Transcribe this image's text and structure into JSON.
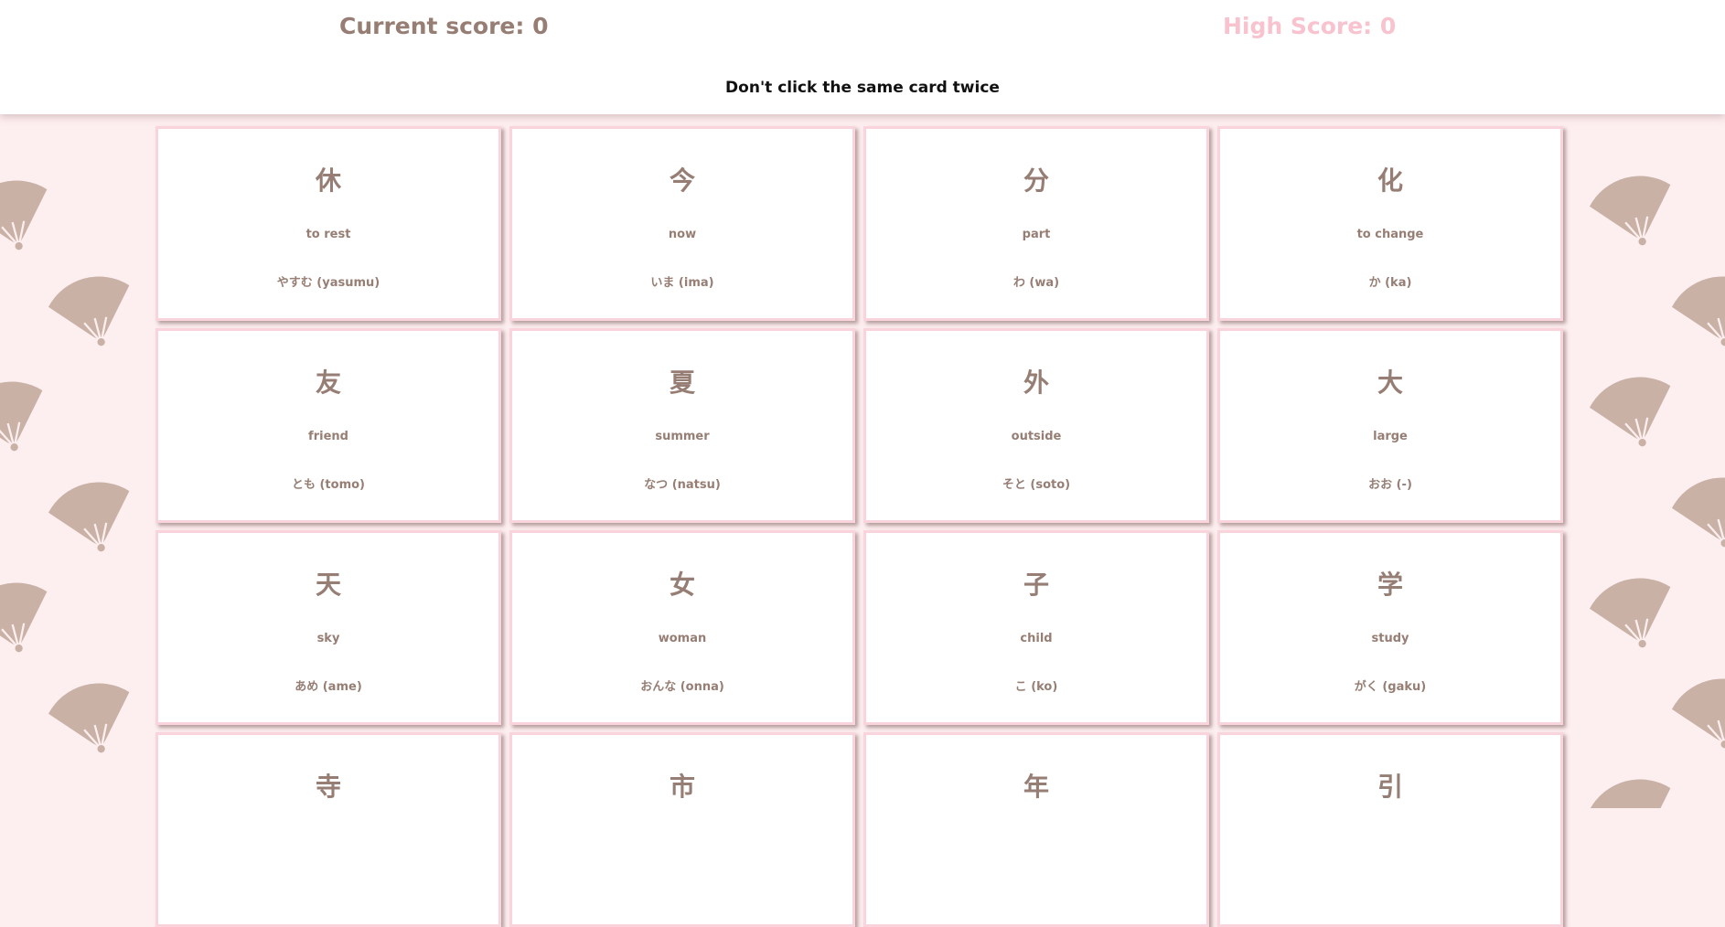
{
  "scoreboard": {
    "current_label": "Current score: 0",
    "high_label": "High Score: 0"
  },
  "instructions": "Don't click the same card twice",
  "theme": {
    "background": "#fdeef0",
    "text": "#977e74",
    "high_score": "#f8c3cf",
    "fan": "#c9b1a6",
    "card_border": "#fad4dc"
  },
  "background_icon": "paper-fan-icon",
  "cards": [
    {
      "kanji": "休",
      "meaning": "to rest",
      "reading": "やすむ (yasumu)"
    },
    {
      "kanji": "今",
      "meaning": "now",
      "reading": "いま (ima)"
    },
    {
      "kanji": "分",
      "meaning": "part",
      "reading": "わ (wa)"
    },
    {
      "kanji": "化",
      "meaning": "to change",
      "reading": "か (ka)"
    },
    {
      "kanji": "友",
      "meaning": "friend",
      "reading": "とも (tomo)"
    },
    {
      "kanji": "夏",
      "meaning": "summer",
      "reading": "なつ (natsu)"
    },
    {
      "kanji": "外",
      "meaning": "outside",
      "reading": "そと (soto)"
    },
    {
      "kanji": "大",
      "meaning": "large",
      "reading": "おお (-)"
    },
    {
      "kanji": "天",
      "meaning": "sky",
      "reading": "あめ (ame)"
    },
    {
      "kanji": "女",
      "meaning": "woman",
      "reading": "おんな (onna)"
    },
    {
      "kanji": "子",
      "meaning": "child",
      "reading": "こ (ko)"
    },
    {
      "kanji": "学",
      "meaning": "study",
      "reading": "がく (gaku)"
    },
    {
      "kanji": "寺",
      "meaning": "",
      "reading": ""
    },
    {
      "kanji": "市",
      "meaning": "",
      "reading": ""
    },
    {
      "kanji": "年",
      "meaning": "",
      "reading": ""
    },
    {
      "kanji": "引",
      "meaning": "",
      "reading": ""
    }
  ]
}
